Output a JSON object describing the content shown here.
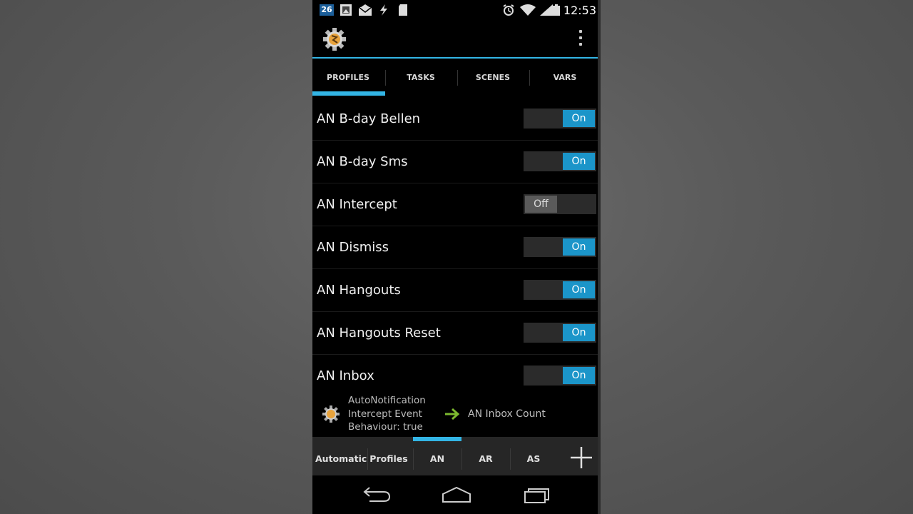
{
  "status_bar": {
    "notification_badge": "26",
    "time": "12:53"
  },
  "action_bar": {
    "app_icon": "tasker-gear-icon",
    "overflow_icon": "overflow-menu-icon"
  },
  "tabs": [
    {
      "label": "PROFILES",
      "selected": true
    },
    {
      "label": "TASKS",
      "selected": false
    },
    {
      "label": "SCENES",
      "selected": false
    },
    {
      "label": "VARS",
      "selected": false
    }
  ],
  "profiles": [
    {
      "name": "AN B-day Bellen",
      "state": "On"
    },
    {
      "name": "AN B-day Sms",
      "state": "On"
    },
    {
      "name": "AN Intercept",
      "state": "Off"
    },
    {
      "name": "AN Dismiss",
      "state": "On"
    },
    {
      "name": "AN Hangouts",
      "state": "On"
    },
    {
      "name": "AN Hangouts Reset",
      "state": "On"
    },
    {
      "name": "AN Inbox",
      "state": "On"
    }
  ],
  "expanded_profile": {
    "context_line1": "AutoNotification",
    "context_line2": "Intercept Event",
    "context_line3": "Behaviour: true",
    "task": "AN Inbox Count"
  },
  "project_bar": {
    "items": [
      "Automatic",
      "Profiles",
      "AN",
      "AR",
      "AS"
    ],
    "selected": "AN",
    "add_icon": "plus-icon"
  },
  "colors": {
    "accent": "#33b5e5",
    "toggle_on": "#1b95c9",
    "toggle_off": "#5a5a5a",
    "task_arrow": "#7cb82f"
  }
}
